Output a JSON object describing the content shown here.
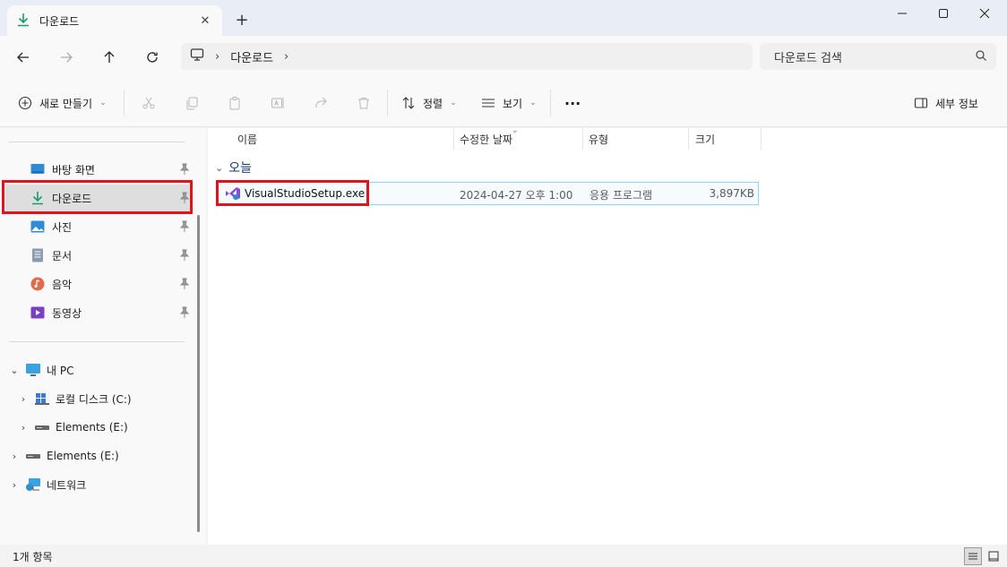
{
  "tab": {
    "title": "다운로드",
    "icon": "download-icon"
  },
  "window": {
    "minimize_icon": "minimize-icon",
    "maximize_icon": "maximize-icon",
    "close_icon": "close-icon"
  },
  "nav": {
    "back_icon": "arrow-left-icon",
    "forward_icon": "arrow-right-icon",
    "up_icon": "arrow-up-icon",
    "refresh_icon": "refresh-icon",
    "address": {
      "breadcrumb": "다운로드"
    },
    "search": {
      "placeholder": "다운로드 검색"
    }
  },
  "command_bar": {
    "new": "새로 만들기",
    "sort": "정렬",
    "view": "보기",
    "more": "···",
    "details": "세부 정보"
  },
  "sidebar": {
    "quick_access": [
      {
        "label": "바탕 화면",
        "icon": "desktop-icon",
        "pinned": true
      },
      {
        "label": "다운로드",
        "icon": "download-icon",
        "pinned": true,
        "selected": true
      },
      {
        "label": "사진",
        "icon": "pictures-icon",
        "pinned": true
      },
      {
        "label": "문서",
        "icon": "documents-icon",
        "pinned": true
      },
      {
        "label": "음악",
        "icon": "music-icon",
        "pinned": true
      },
      {
        "label": "동영상",
        "icon": "videos-icon",
        "pinned": true
      }
    ],
    "tree": [
      {
        "label": "내 PC",
        "expanded": true
      },
      {
        "label": "로컬 디스크 (C:)"
      },
      {
        "label": "Elements (E:)"
      },
      {
        "label": "Elements (E:)"
      },
      {
        "label": "네트워크"
      }
    ]
  },
  "columns": [
    "이름",
    "수정한 날짜",
    "유형",
    "크기"
  ],
  "group": {
    "label": "오늘"
  },
  "files": [
    {
      "name": "VisualStudioSetup.exe",
      "modified": "2024-04-27 오후 1:00",
      "type": "응용 프로그램",
      "size": "3,897KB"
    }
  ],
  "status": {
    "item_count": "1개 항목"
  },
  "colors": {
    "accent_green": "#1e9b6b",
    "highlight_red": "#e3131e",
    "selection_border": "#99d1f2"
  }
}
